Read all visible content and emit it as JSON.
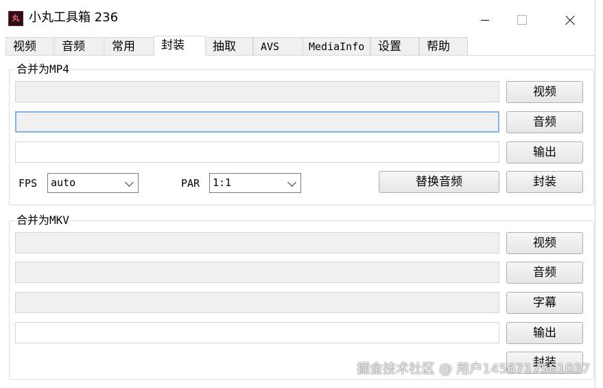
{
  "window": {
    "title": "小丸工具箱 236",
    "icon_text": "丸"
  },
  "tabs": [
    "视频",
    "音频",
    "常用",
    "封装",
    "抽取",
    "AVS",
    "MediaInfo",
    "设置",
    "帮助"
  ],
  "active_tab": "封装",
  "mp4": {
    "title": "合并为MP4",
    "video_btn": "视频",
    "audio_btn": "音频",
    "output_btn": "输出",
    "fps_label": "FPS",
    "fps_value": "auto",
    "par_label": "PAR",
    "par_value": "1:1",
    "replace_audio_btn": "替换音频",
    "mux_btn": "封装"
  },
  "mkv": {
    "title": "合并为MKV",
    "video_btn": "视频",
    "audio_btn": "音频",
    "subtitle_btn": "字幕",
    "output_btn": "输出",
    "mux_btn": "封装"
  },
  "watermark": "掘金技术社区 @ 用户1456717561037"
}
